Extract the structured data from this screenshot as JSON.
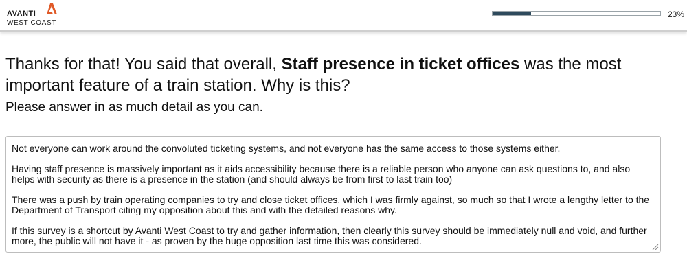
{
  "header": {
    "logo_line1": "AVANTI",
    "logo_line2": "WEST COAST",
    "brand_color": "#e05a28",
    "progress_value": 23,
    "progress_label": "23%",
    "progress_color": "#2e4a5c"
  },
  "question": {
    "intro": "Thanks for that! You said that overall, ",
    "highlight": "Staff presence in ticket offices",
    "rest": " was the most important feature of a train station. Why is this?",
    "instructions": "Please answer in as much detail as you can."
  },
  "answer": {
    "paragraphs": [
      "Not everyone can work around the convoluted ticketing systems, and not everyone has the same access to those systems either.",
      "Having staff presence is massively important as it aids accessibility because there is a reliable person who anyone can ask questions to, and also helps with security as there is a presence in the station (and should always be from first to last train too)",
      "There was a push by train operating companies to try and close ticket offices, which I was firmly against, so much so that I wrote a lengthy letter to the Department of Transport citing my opposition about this and with the detailed reasons why.",
      "If this survey is a shortcut by Avanti West Coast to try and gather information, then clearly this survey should be immediately null and void, and further more, the public will not have it - as proven by the huge opposition last time this was considered."
    ]
  }
}
